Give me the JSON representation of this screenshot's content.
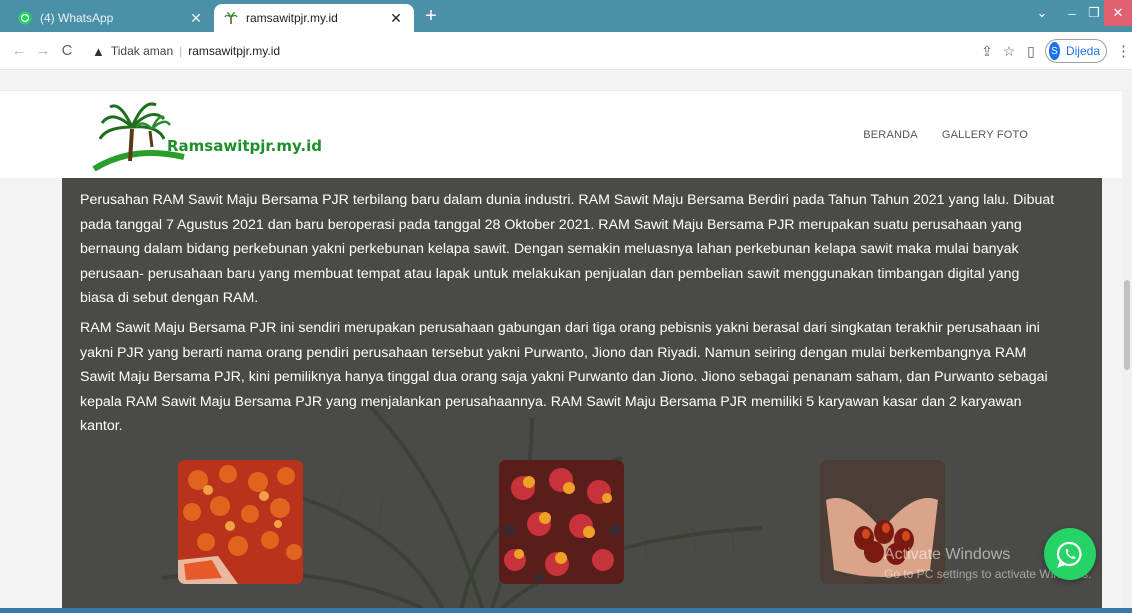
{
  "browser": {
    "tabs": [
      {
        "label": "(4) WhatsApp",
        "icon": "whatsapp-icon",
        "active": false
      },
      {
        "label": "ramsawitpjr.my.id",
        "icon": "palm-favicon-icon",
        "active": true
      }
    ],
    "address": {
      "security_text": "Tidak aman",
      "url": "ramsawitpjr.my.id"
    },
    "profile": {
      "initial": "S",
      "label": "Dijeda"
    }
  },
  "site": {
    "logo_text": "Ramsawitpjr.my.id",
    "nav": [
      "BERANDA",
      "GALLERY FOTO"
    ]
  },
  "content": {
    "paragraph1": "Perusahan RAM Sawit Maju Bersama PJR terbilang baru dalam dunia industri. RAM Sawit Maju Bersama Berdiri pada Tahun Tahun 2021 yang lalu. Dibuat pada tanggal 7 Agustus 2021 dan baru beroperasi pada tanggal 28 Oktober 2021. RAM Sawit Maju Bersama PJR merupakan suatu perusahaan yang bernaung dalam bidang perkebunan yakni perkebunan kelapa sawit. Dengan semakin meluasnya lahan perkebunan  kelapa sawit maka mulai banyak perusaan- perusahaan baru yang membuat tempat atau lapak untuk melakukan penjualan dan pembelian sawit menggunakan timbangan digital yang biasa di sebut dengan RAM.",
    "paragraph2": "RAM Sawit Maju Bersama PJR ini sendiri merupakan perusahaan gabungan dari tiga orang pebisnis yakni berasal dari singkatan terakhir perusahaan ini yakni PJR yang berarti nama orang pendiri perusahaan tersebut yakni Purwanto, Jiono dan Riyadi. Namun seiring dengan mulai berkembangnya RAM Sawit Maju Bersama PJR, kini pemiliknya hanya tinggal dua orang saja yakni Purwanto dan Jiono. Jiono sebagai penanam saham, dan Purwanto sebagai kepala RAM Sawit Maju Bersama PJR yang menjalankan perusahaannya. RAM Sawit Maju Bersama PJR memiliki 5 karyawan kasar dan 2 karyawan kantor."
  },
  "overlay": {
    "watermark_line1": "Activate Windows",
    "watermark_line2": "Go to PC settings to activate Windows."
  },
  "colors": {
    "tabbar": "#4a90a8",
    "content_bg": "#4a4a47",
    "logo_green": "#1f8f2a",
    "whatsapp": "#25d366"
  }
}
